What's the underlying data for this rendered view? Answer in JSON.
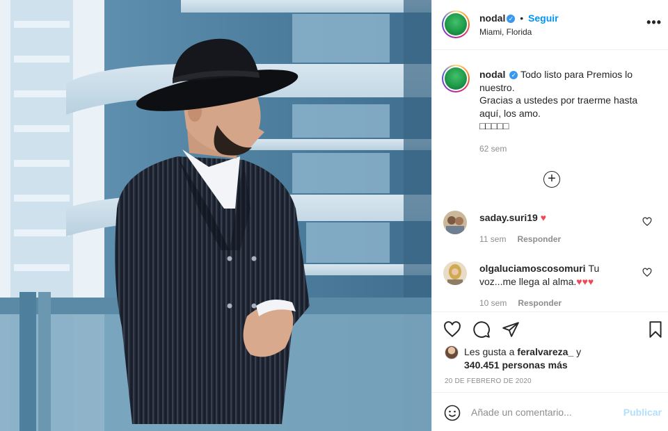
{
  "header": {
    "username": "nodal",
    "separator": "•",
    "follow_label": "Seguir",
    "location": "Miami, Florida",
    "more_label": "•••"
  },
  "caption": {
    "username": "nodal",
    "line1": "Todo listo para Premios lo nuestro.",
    "line2": "Gracias a ustedes por traerme hasta aquí, los amo.",
    "emojis": "□□□□□",
    "time": "62 sem"
  },
  "load_more_label": "+",
  "comments": [
    {
      "username": "saday.suri19",
      "text": "",
      "emoji": "♥",
      "time": "11 sem",
      "reply_label": "Responder"
    },
    {
      "username": "olgaluciamoscosomuri",
      "text": "Tu voz...me llega al alma.",
      "emoji": "♥♥♥",
      "time": "10 sem",
      "reply_label": "Responder"
    }
  ],
  "likes": {
    "prefix": "Les gusta a",
    "user": "feralvareza_",
    "joiner": "y",
    "count_text": "340.451 personas más"
  },
  "post_date": "20 DE FEBRERO DE 2020",
  "add_comment": {
    "placeholder": "Añade un comentario...",
    "publish_label": "Publicar"
  },
  "icons": {
    "verified": "verified-badge-icon",
    "like": "heart-icon",
    "comment": "comment-bubble-icon",
    "share": "paper-plane-icon",
    "save": "bookmark-icon",
    "emoji": "smiley-icon",
    "load_more": "plus-circle-icon"
  },
  "colors": {
    "accent": "#0095f6",
    "publish_disabled": "#b2dffc",
    "heart_red": "#ed4956",
    "muted": "#8e8e8e"
  }
}
